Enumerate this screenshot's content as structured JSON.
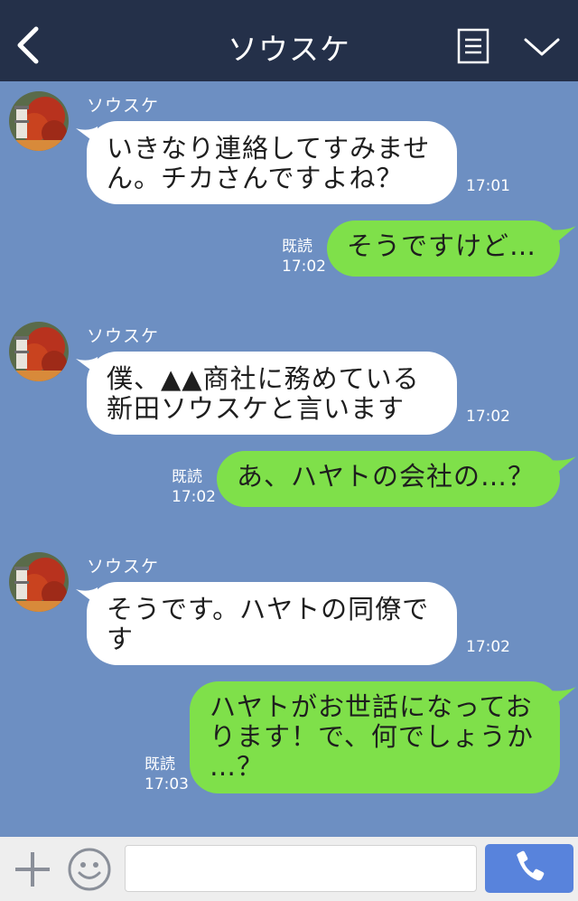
{
  "header": {
    "title": "ソウスケ"
  },
  "colors": {
    "header_bg": "#243049",
    "chat_bg": "#6d8fc2",
    "incoming_bubble": "#ffffff",
    "outgoing_bubble": "#7fe04a",
    "call_button": "#5883dc"
  },
  "messages": [
    {
      "direction": "in",
      "sender": "ソウスケ",
      "text": "いきなり連絡してすみませ\nん。チカさんですよね？",
      "time": "17:01"
    },
    {
      "direction": "out",
      "text": "そうですけど…",
      "read": "既読",
      "time": "17:02"
    },
    {
      "direction": "in",
      "sender": "ソウスケ",
      "text": "僕、▲▲商社に務めている\n新田ソウスケと言います",
      "time": "17:02"
    },
    {
      "direction": "out",
      "text": "あ、ハヤトの会社の…？",
      "read": "既読",
      "time": "17:02"
    },
    {
      "direction": "in",
      "sender": "ソウスケ",
      "text": "そうです。ハヤトの同僚で\nす",
      "time": "17:02"
    },
    {
      "direction": "out",
      "text": "ハヤトがお世話になってお\nります！で、何でしょうか\n…？",
      "read": "既読",
      "time": "17:03"
    }
  ],
  "icons": {
    "back": "chevron-left-icon",
    "menu": "menu-icon",
    "collapse": "chevron-down-icon",
    "add": "plus-icon",
    "emoji": "smiley-icon",
    "call": "phone-icon"
  },
  "input": {
    "placeholder": ""
  }
}
